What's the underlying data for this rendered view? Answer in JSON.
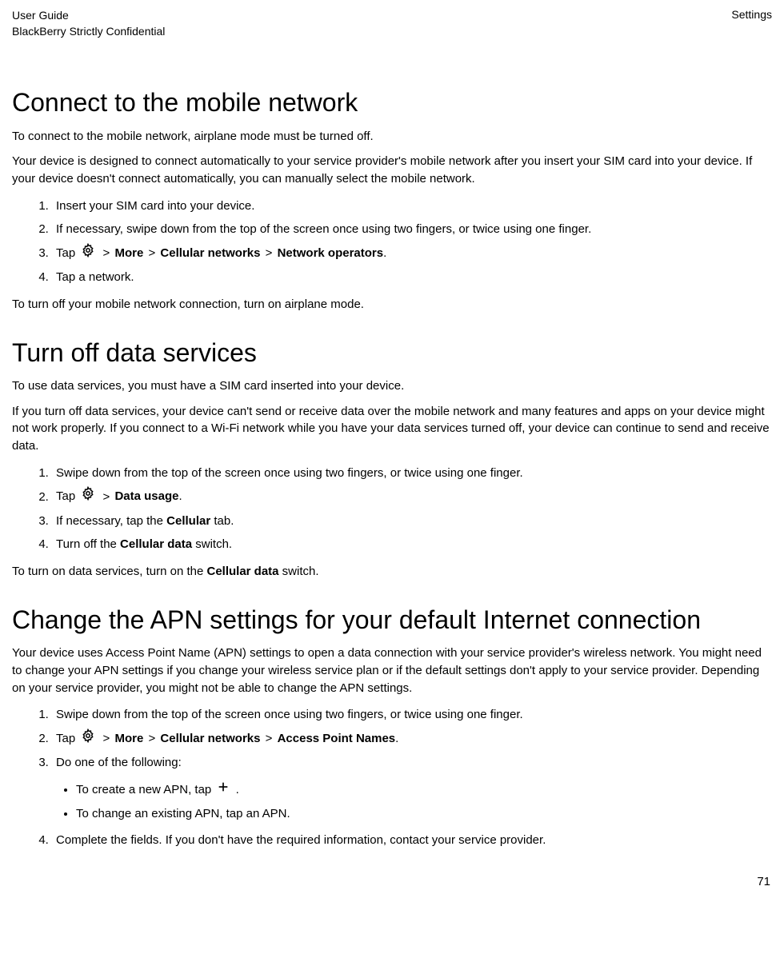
{
  "header": {
    "left_line1": "User Guide",
    "left_line2": "BlackBerry Strictly Confidential",
    "right": "Settings"
  },
  "sections": {
    "s1": {
      "title": "Connect to the mobile network",
      "p1": "To connect to the mobile network, airplane mode must be turned off.",
      "p2": "Your device is designed to connect automatically to your service provider's mobile network after you insert your SIM card into your device. If your device doesn't connect automatically, you can manually select the mobile network.",
      "steps": {
        "s1": "Insert your SIM card into your device.",
        "s2": "If necessary, swipe down from the top of the screen once using two fingers, or twice using one finger.",
        "s3_pre": "Tap ",
        "s3_sep": " > ",
        "s3_b1": "More",
        "s3_b2": "Cellular networks",
        "s3_b3": "Network operators",
        "s3_end": ".",
        "s4": "Tap a network."
      },
      "p3": "To turn off your mobile network connection, turn on airplane mode."
    },
    "s2": {
      "title": "Turn off data services",
      "p1": "To use data services, you must have a SIM card inserted into your device.",
      "p2": "If you turn off data services, your device can't send or receive data over the mobile network and many features and apps on your device might not work properly. If you connect to a Wi-Fi network while you have your data services turned off, your device can continue to send and receive data.",
      "steps": {
        "s1": "Swipe down from the top of the screen once using two fingers, or twice using one finger.",
        "s2_pre": "Tap ",
        "s2_sep": " > ",
        "s2_b1": "Data usage",
        "s2_end": ".",
        "s3_pre": "If necessary, tap the ",
        "s3_b1": "Cellular",
        "s3_post": " tab.",
        "s4_pre": "Turn off the ",
        "s4_b1": "Cellular data",
        "s4_post": " switch."
      },
      "p3_pre": "To turn on data services, turn on the ",
      "p3_b1": "Cellular data",
      "p3_post": " switch."
    },
    "s3": {
      "title": "Change the APN settings for your default Internet connection",
      "p1": "Your device uses Access Point Name (APN) settings to open a data connection with your service provider's wireless network. You might need to change your APN settings if you change your wireless service plan or if the default settings don't apply to your service provider. Depending on your service provider, you might not be able to change the APN settings.",
      "steps": {
        "s1": "Swipe down from the top of the screen once using two fingers, or twice using one finger.",
        "s2_pre": "Tap ",
        "s2_sep": " > ",
        "s2_b1": "More",
        "s2_b2": "Cellular networks",
        "s2_b3": "Access Point Names",
        "s2_end": ".",
        "s3": "Do one of the following:",
        "sub1_pre": "To create a new APN, tap ",
        "sub1_end": " .",
        "sub2": " To change an existing APN, tap an APN.",
        "s4": "Complete the fields. If you don't have the required information, contact your service provider."
      }
    }
  },
  "page_number": "71"
}
